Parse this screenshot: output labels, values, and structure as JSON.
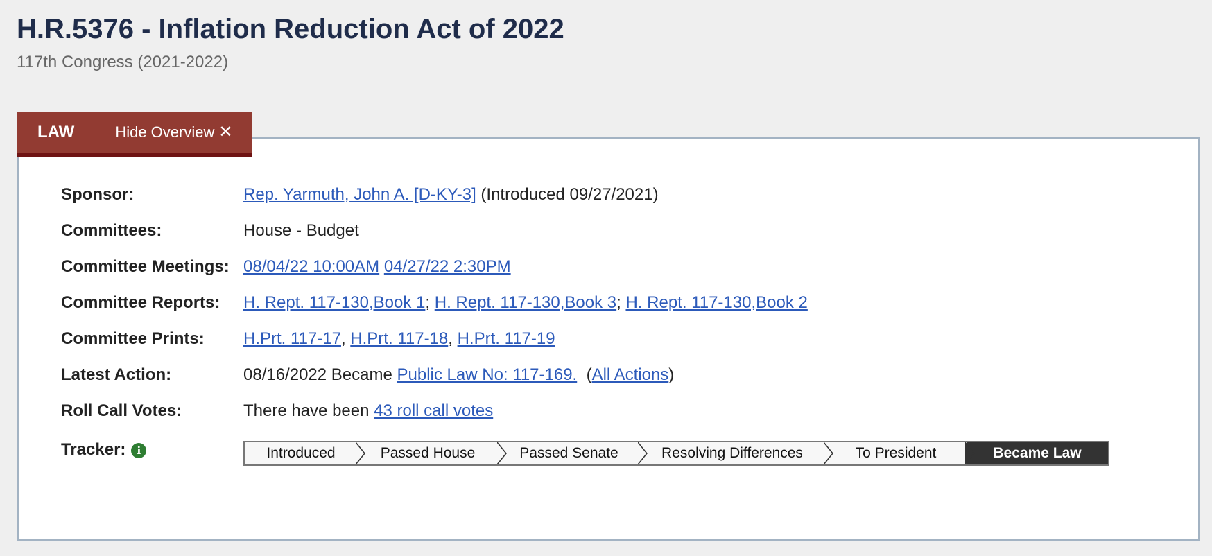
{
  "header": {
    "title": "H.R.5376 - Inflation Reduction Act of 2022",
    "subtitle": "117th Congress (2021-2022)"
  },
  "tabs": {
    "status_label": "LAW",
    "hide_label": "Hide Overview",
    "hide_icon": "close-icon"
  },
  "overview": {
    "sponsor": {
      "label": "Sponsor:",
      "link": "Rep. Yarmuth, John A. [D-KY-3]",
      "suffix": "(Introduced 09/27/2021)"
    },
    "committees": {
      "label": "Committees:",
      "value": "House - Budget"
    },
    "meetings": {
      "label": "Committee Meetings:",
      "links": [
        "08/04/22 10:00AM",
        "04/27/22 2:30PM"
      ]
    },
    "reports": {
      "label": "Committee Reports:",
      "links": [
        "H. Rept. 117-130,Book 1",
        "H. Rept. 117-130,Book 3",
        "H. Rept. 117-130,Book 2"
      ],
      "separator": ";"
    },
    "prints": {
      "label": "Committee Prints:",
      "links": [
        "H.Prt. 117-17",
        "H.Prt. 117-18",
        "H.Prt. 117-19"
      ],
      "separator": ","
    },
    "latest_action": {
      "label": "Latest Action:",
      "prefix": "08/16/2022 Became",
      "link": "Public Law No: 117-169.",
      "paren_open": "(",
      "all_actions": "All Actions",
      "paren_close": ")"
    },
    "roll_call": {
      "label": "Roll Call Votes:",
      "prefix": "There have been",
      "link": "43 roll call votes"
    },
    "tracker": {
      "label": "Tracker:",
      "info_icon": "info-icon",
      "steps": [
        "Introduced",
        "Passed House",
        "Passed Senate",
        "Resolving Differences",
        "To President",
        "Became Law"
      ],
      "current_index": 5
    }
  },
  "colors": {
    "tab_bg": "#923b32",
    "link": "#2c5aba",
    "title": "#1f2c4a",
    "tracker_current": "#333333"
  }
}
